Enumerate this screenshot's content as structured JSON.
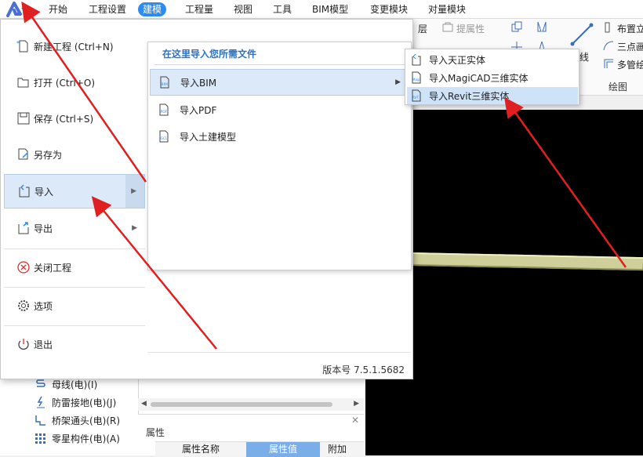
{
  "menubar": {
    "tabs": [
      {
        "label": "开始"
      },
      {
        "label": "工程设置"
      },
      {
        "label": "建模"
      },
      {
        "label": "工程量"
      },
      {
        "label": "视图"
      },
      {
        "label": "工具"
      },
      {
        "label": "BIM模型"
      },
      {
        "label": "变更模块"
      },
      {
        "label": "对量模块"
      }
    ],
    "active_tab": "建模"
  },
  "ribbon": {
    "layer_label": "层",
    "prop_label": "提属性",
    "line_label": "线",
    "buzhili_label": "布置立",
    "sandian_label": "三点画",
    "duoguan_label": "多管绘",
    "group_label": "绘图"
  },
  "app_menu": {
    "items": [
      {
        "label": "新建工程 (Ctrl+N)",
        "icon": "new-file-icon"
      },
      {
        "label": "打开 (Ctrl+O)",
        "icon": "open-folder-icon"
      },
      {
        "label": "保存 (Ctrl+S)",
        "icon": "save-icon"
      },
      {
        "label": "另存为",
        "icon": "save-as-icon"
      },
      {
        "label": "导入",
        "icon": "import-icon"
      },
      {
        "label": "导出",
        "icon": "export-icon"
      },
      {
        "label": "关闭工程",
        "icon": "close-circle-icon"
      },
      {
        "label": "选项",
        "icon": "gear-icon"
      },
      {
        "label": "退出",
        "icon": "power-icon"
      }
    ],
    "selected": "导入"
  },
  "import_panel": {
    "title": "在这里导入您所需文件",
    "items": [
      {
        "label": "导入BIM",
        "icon": "bim-file-icon"
      },
      {
        "label": "导入PDF",
        "icon": "pdf-file-icon"
      },
      {
        "label": "导入土建模型",
        "icon": "model-file-icon"
      }
    ],
    "selected": "导入BIM",
    "version": "版本号 7.5.1.5682"
  },
  "bim_submenu": {
    "items": [
      {
        "label": "导入天正实体",
        "icon": "tangent-icon"
      },
      {
        "label": "导入MagiCAD三维实体",
        "icon": "magicad-icon"
      },
      {
        "label": "导入Revit三维实体",
        "icon": "revit-icon"
      }
    ],
    "selected": "导入Revit三维实体"
  },
  "tree": {
    "items": [
      {
        "label": "母线(电)(I)",
        "icon": "busbar-icon"
      },
      {
        "label": "防雷接地(电)(J)",
        "icon": "lightning-ground-icon"
      },
      {
        "label": "桥架通头(电)(R)",
        "icon": "tray-joint-icon"
      },
      {
        "label": "零星构件(电)(A)",
        "icon": "misc-component-icon"
      }
    ]
  },
  "properties": {
    "title": "属性",
    "columns": [
      "属性名称",
      "属性值",
      "附加"
    ]
  },
  "colors": {
    "accent": "#2d8cf0",
    "selection": "#dbe9f8",
    "annotation_arrow": "#e02020",
    "canvas": "#000000"
  }
}
